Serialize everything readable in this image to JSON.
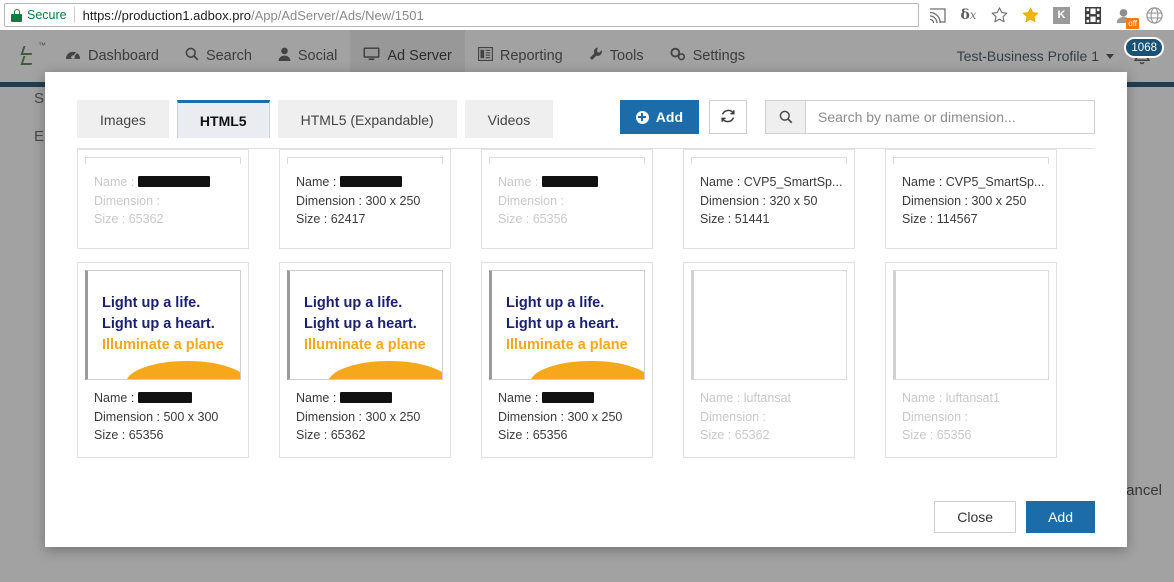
{
  "browser": {
    "security_label": "Secure",
    "url_domain": "https://production1.adbox.pro",
    "url_path": "/App/AdServer/Ads/New/1501",
    "extensions": [
      {
        "name": "cast-icon",
        "glyph": "cast"
      },
      {
        "name": "delta-x-icon",
        "glyph": "δx"
      },
      {
        "name": "bookmark-star-outline-icon",
        "glyph": "star-outline"
      },
      {
        "name": "bookmark-star-filled-icon",
        "glyph": "star-filled"
      },
      {
        "name": "kaspersky-k-icon",
        "glyph": "K"
      },
      {
        "name": "filmstrip-icon",
        "glyph": "film"
      },
      {
        "name": "avatar-extension-icon",
        "glyph": "avatar",
        "badge": "off"
      },
      {
        "name": "globe-icon",
        "glyph": "globe"
      }
    ]
  },
  "nav": {
    "items": [
      {
        "label": "Dashboard",
        "icon": "dashboard-icon",
        "active": false
      },
      {
        "label": "Search",
        "icon": "search-icon",
        "active": false
      },
      {
        "label": "Social",
        "icon": "user-icon",
        "active": false
      },
      {
        "label": "Ad Server",
        "icon": "monitor-icon",
        "active": true
      },
      {
        "label": "Reporting",
        "icon": "report-icon",
        "active": false
      },
      {
        "label": "Tools",
        "icon": "wrench-icon",
        "active": false
      },
      {
        "label": "Settings",
        "icon": "gears-icon",
        "active": false
      }
    ],
    "profile_label": "Test-Business Profile 1",
    "notification_count": "1068"
  },
  "background_page": {
    "text_top": "S",
    "text_left": "E",
    "cancel_label": "Cancel"
  },
  "modal": {
    "tabs": [
      {
        "label": "Images",
        "active": false
      },
      {
        "label": "HTML5",
        "active": true
      },
      {
        "label": "HTML5 (Expandable)",
        "active": false
      },
      {
        "label": "Videos",
        "active": false
      }
    ],
    "add_button_label": "Add",
    "refresh_icon": "refresh-icon",
    "search": {
      "icon": "search-icon",
      "placeholder": "Search by name or dimension...",
      "value": ""
    },
    "labels": {
      "name": "Name :",
      "dimension": "Dimension :",
      "size": "Size :"
    },
    "creative_ad": {
      "line1": "Light up a life.",
      "line2": "Light up a heart.",
      "line3": "Illuminate a plane"
    },
    "cards": [
      {
        "row": 1,
        "preview": "clipped",
        "enabled": false,
        "name": "",
        "name_redacted": true,
        "redact_width": 72,
        "dimension": "",
        "size": "65362"
      },
      {
        "row": 1,
        "preview": "clipped",
        "enabled": true,
        "name": "",
        "name_redacted": true,
        "redact_width": 62,
        "dimension": "300 x 250",
        "size": "62417"
      },
      {
        "row": 1,
        "preview": "clipped",
        "enabled": false,
        "name": "",
        "name_redacted": true,
        "redact_width": 56,
        "dimension": "",
        "size": "65356"
      },
      {
        "row": 1,
        "preview": "clipped",
        "enabled": true,
        "name": "CVP5_SmartSp...",
        "name_redacted": false,
        "dimension": "320 x 50",
        "size": "51441"
      },
      {
        "row": 1,
        "preview": "clipped",
        "enabled": true,
        "name": "CVP5_SmartSp...",
        "name_redacted": false,
        "dimension": "300 x 250",
        "size": "114567"
      },
      {
        "row": 2,
        "preview": "creative",
        "enabled": true,
        "name": "",
        "name_redacted": true,
        "redact_width": 54,
        "dimension": "500 x 300",
        "size": "65356"
      },
      {
        "row": 2,
        "preview": "creative",
        "enabled": true,
        "name": "",
        "name_redacted": true,
        "redact_width": 52,
        "dimension": "300 x 250",
        "size": "65362"
      },
      {
        "row": 2,
        "preview": "creative",
        "enabled": true,
        "name": "",
        "name_redacted": true,
        "redact_width": 52,
        "dimension": "300 x 250",
        "size": "65356"
      },
      {
        "row": 2,
        "preview": "empty",
        "enabled": false,
        "name": "luftansat",
        "name_redacted": false,
        "dimension": "",
        "size": "65362"
      },
      {
        "row": 2,
        "preview": "empty",
        "enabled": false,
        "name": "luftansat1",
        "name_redacted": false,
        "dimension": "",
        "size": "65356"
      }
    ],
    "footer": {
      "close_label": "Close",
      "add_label": "Add"
    }
  },
  "colors": {
    "brand_blue": "#1b6ca8",
    "nav_dark": "#0b3e63",
    "ad_navy": "#1b2070",
    "ad_amber": "#f5a81c",
    "secure_green": "#0b7d3e"
  }
}
